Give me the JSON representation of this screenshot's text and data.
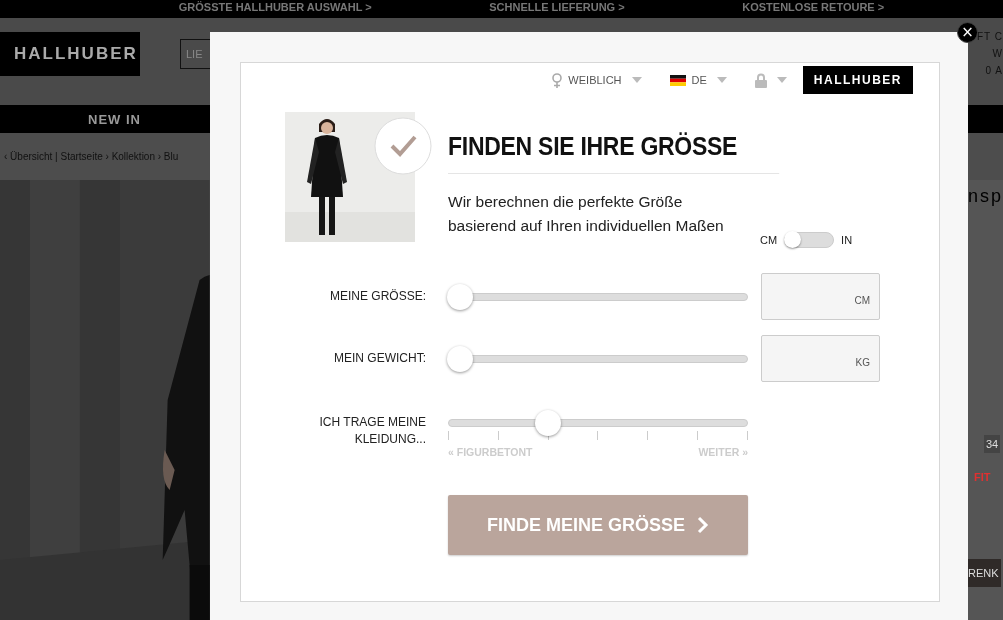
{
  "promo_bar": [
    "GRÖSSTE HALLHUBER AUSWAHL >",
    "SCHNELLE LIEFERUNG >",
    "KOSTENLOSE RETOURE >"
  ],
  "header": {
    "logo": "HALLHUBER",
    "search_text": "LIE",
    "right_texts": [
      "FT C",
      "W",
      "0 A"
    ]
  },
  "nav": {
    "items": [
      "NEW IN"
    ]
  },
  "breadcrumb": "‹ Übersicht | Startseite › Kollektion › Blu",
  "product": {
    "title_fragment": "nsp",
    "size_value": "34",
    "fit_label": "FIT",
    "button_fragment": "RENK"
  },
  "modal": {
    "close": "×",
    "gender": "WEIBLICH",
    "language": "DE",
    "brand": "HALLHUBER",
    "title": "FINDEN SIE IHRE GRÖSSE",
    "subtitle": "Wir berechnen die perfekte Größe basierend auf Ihren individuellen Maßen",
    "unit_toggle": {
      "left": "CM",
      "right": "IN",
      "on": false
    },
    "sliders": [
      {
        "kind": "measure",
        "label": "MEINE GRÖSSE:",
        "level": 0,
        "unit": "CM"
      },
      {
        "kind": "measure",
        "label": "MEIN GEWICHT:",
        "level": 0,
        "unit": "KG"
      },
      {
        "kind": "scale",
        "label": "ICH TRAGE MEINE KLEIDUNG...",
        "level": 0.333,
        "left_label": "« FIGURBETONT",
        "right_label": "WEITER »"
      }
    ],
    "submit": "FINDE MEINE GRÖSSE"
  }
}
